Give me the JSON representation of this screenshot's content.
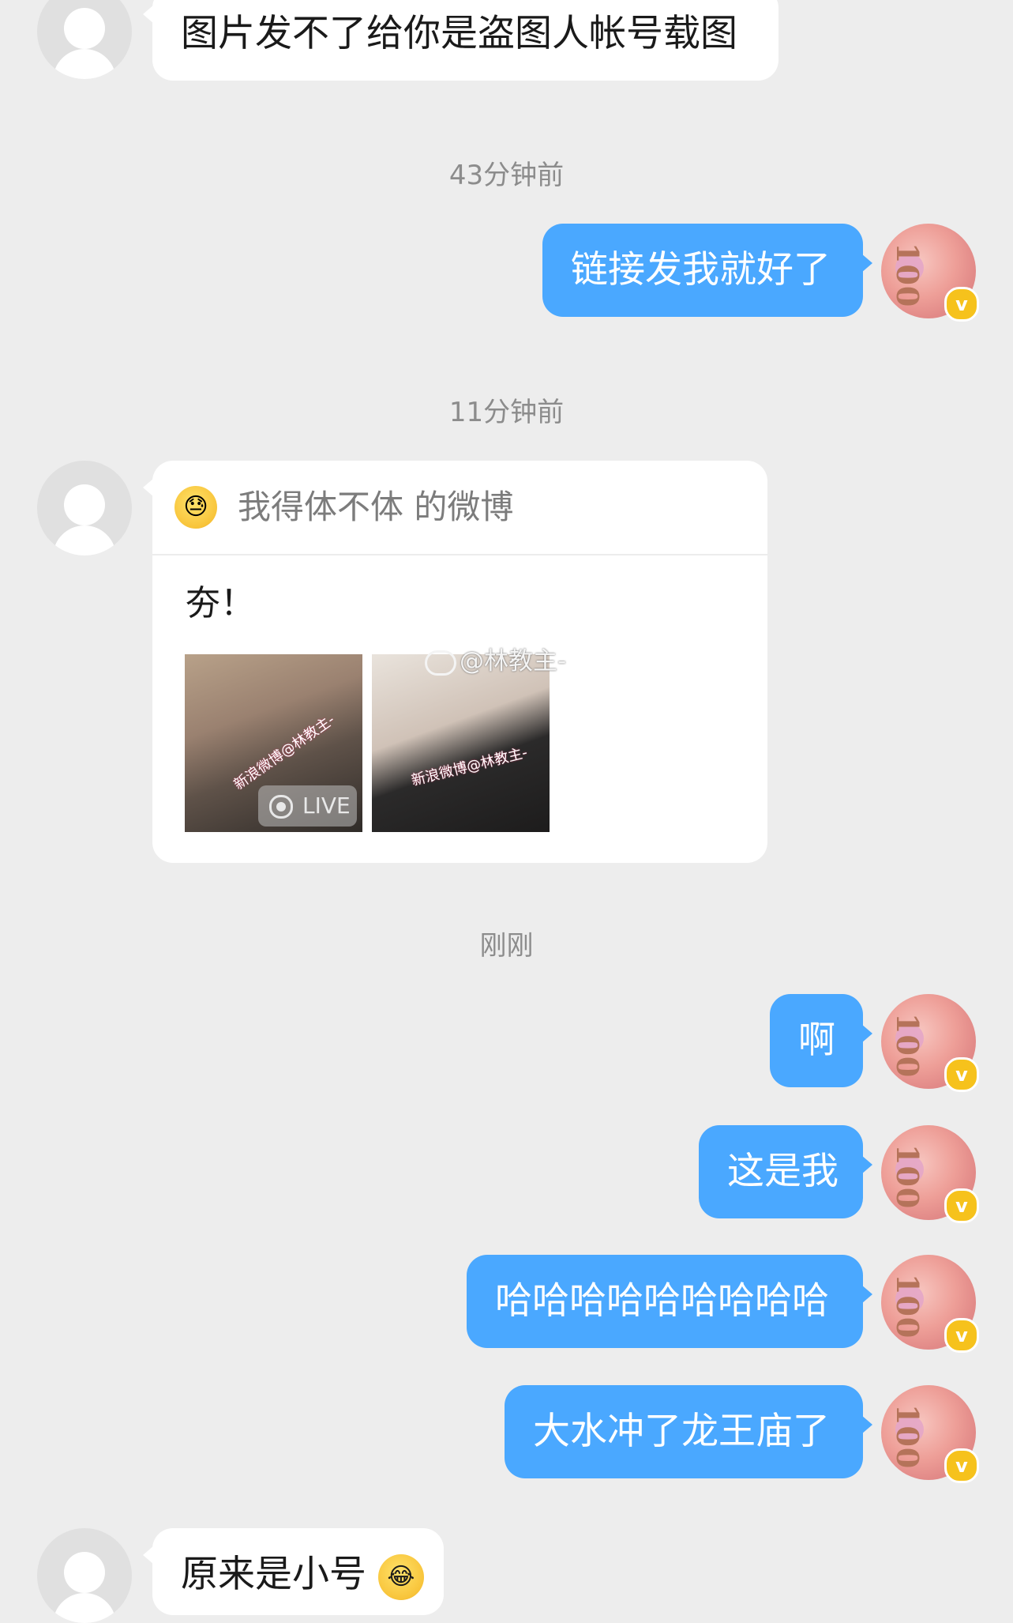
{
  "messages": [
    {
      "side": "in",
      "text": "图片发不了给你是盗图人帐号载图"
    },
    {
      "side": "out",
      "text": "链接发我就好了"
    },
    {
      "side": "out",
      "text": "啊"
    },
    {
      "side": "out",
      "text": "这是我"
    },
    {
      "side": "out",
      "text": "哈哈哈哈哈哈哈哈哈"
    },
    {
      "side": "out",
      "text": "大水冲了龙王庙了"
    },
    {
      "side": "in",
      "text": "原来是小号"
    }
  ],
  "timestamps": [
    "43分钟前",
    "11分钟前",
    "刚刚"
  ],
  "shared_card": {
    "title": "我得体不体 的微博",
    "text": "夯！",
    "thumb1_watermark": "新浪微博@林教主-",
    "thumb2_watermark": "新浪微博@林教主-",
    "live_label": "LIVE",
    "weibo_watermark": "@林教主-"
  },
  "avatar_badge": "v",
  "banknote_text": "100",
  "colors": {
    "background": "#ededed",
    "out_bubble": "#4aa8ff",
    "in_bubble": "#ffffff",
    "time": "#8c8c8c",
    "badge": "#f6c21c"
  },
  "icons": [
    "default-avatar-icon",
    "verified-badge-icon",
    "emoji-icon",
    "live-photo-icon",
    "weibo-logo-icon",
    "laughing-crying-emoji-icon"
  ]
}
